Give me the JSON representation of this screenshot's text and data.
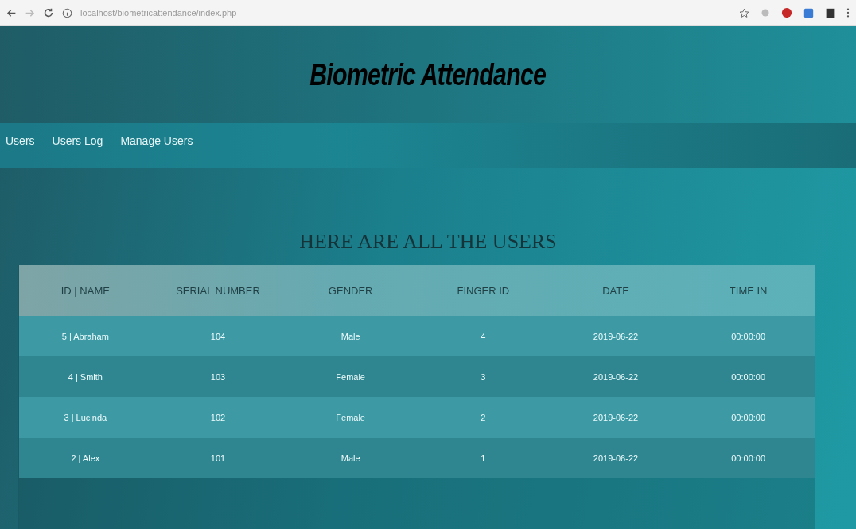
{
  "browser": {
    "url": "localhost/biometricattendance/index.php"
  },
  "header": {
    "title": "Biometric Attendance"
  },
  "nav": {
    "items": [
      {
        "label": "Users"
      },
      {
        "label": "Users Log"
      },
      {
        "label": "Manage Users"
      }
    ]
  },
  "heading": "HERE ARE ALL THE USERS",
  "table": {
    "columns": [
      "ID | NAME",
      "SERIAL NUMBER",
      "GENDER",
      "FINGER ID",
      "DATE",
      "TIME IN"
    ],
    "rows": [
      [
        "5 | Abraham",
        "104",
        "Male",
        "4",
        "2019-06-22",
        "00:00:00"
      ],
      [
        "4 | Smith",
        "103",
        "Female",
        "3",
        "2019-06-22",
        "00:00:00"
      ],
      [
        "3 | Lucinda",
        "102",
        "Female",
        "2",
        "2019-06-22",
        "00:00:00"
      ],
      [
        "2 | Alex",
        "101",
        "Male",
        "1",
        "2019-06-22",
        "00:00:00"
      ]
    ]
  }
}
